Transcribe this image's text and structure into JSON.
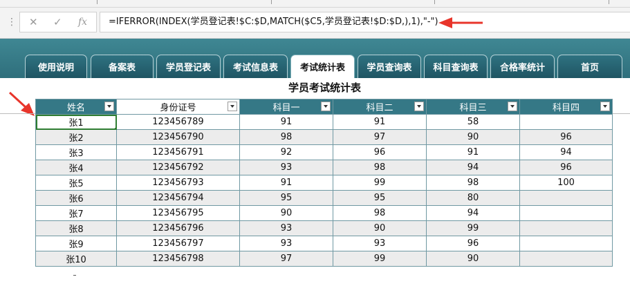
{
  "formula_bar": {
    "cancel_icon": "x-icon",
    "enter_icon": "check-icon",
    "function_icon": "fx-icon",
    "formula": "=IFERROR(INDEX(学员登记表!$C:$D,MATCH($C5,学员登记表!$D:$D,),1),\"-\")"
  },
  "tabs": [
    "使用说明",
    "备案表",
    "学员登记表",
    "考试信息表",
    "考试统计表",
    "学员查询表",
    "科目查询表",
    "合格率统计",
    "首页"
  ],
  "active_tab": "考试统计表",
  "sheet_title": "学员考试统计表",
  "table": {
    "headers": [
      "姓名",
      "身份证号",
      "科目一",
      "科目二",
      "科目三",
      "科目四"
    ],
    "rows": [
      [
        "张1",
        "123456789",
        "91",
        "91",
        "58",
        ""
      ],
      [
        "张2",
        "123456790",
        "98",
        "97",
        "90",
        "96"
      ],
      [
        "张3",
        "123456791",
        "92",
        "96",
        "91",
        "94"
      ],
      [
        "张4",
        "123456792",
        "93",
        "98",
        "94",
        "96"
      ],
      [
        "张5",
        "123456793",
        "91",
        "99",
        "98",
        "100"
      ],
      [
        "张6",
        "123456794",
        "95",
        "95",
        "80",
        ""
      ],
      [
        "张7",
        "123456795",
        "90",
        "98",
        "94",
        ""
      ],
      [
        "张8",
        "123456796",
        "93",
        "90",
        "99",
        ""
      ],
      [
        "张9",
        "123456797",
        "93",
        "93",
        "96",
        ""
      ],
      [
        "张10",
        "123456798",
        "97",
        "99",
        "90",
        ""
      ]
    ]
  },
  "colors": {
    "teal": "#357886",
    "nav_band": "#3f8793",
    "arrow": "#e8352b",
    "selection": "#2e7d32"
  }
}
